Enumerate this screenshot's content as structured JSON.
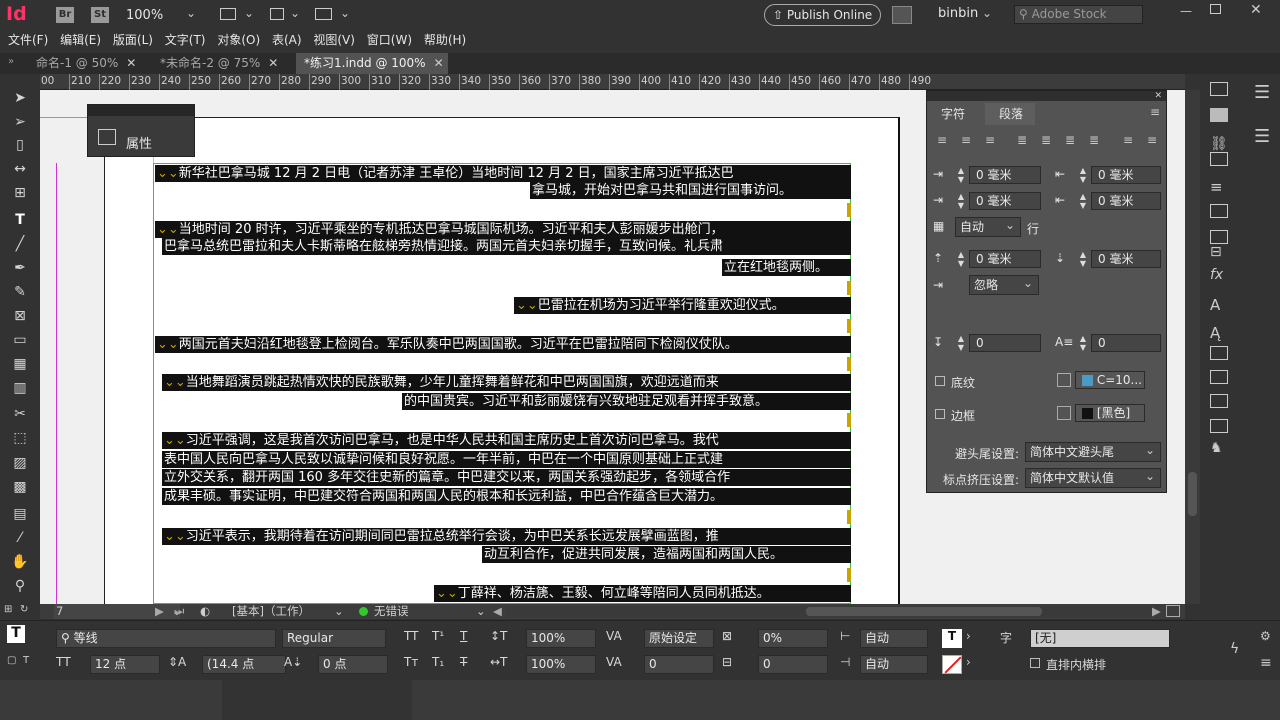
{
  "app": {
    "logo": "Id",
    "br": "Br",
    "st": "St",
    "zoom": "100%",
    "publish_label": "Publish Online",
    "user": "binbin",
    "search_placeholder": "Adobe Stock"
  },
  "menu": [
    "文件(F)",
    "编辑(E)",
    "版面(L)",
    "文字(T)",
    "对象(O)",
    "表(A)",
    "视图(V)",
    "窗口(W)",
    "帮助(H)"
  ],
  "tabs": [
    {
      "label": "命名-1 @ 50%"
    },
    {
      "label": "*未命名-2 @ 75%"
    },
    {
      "label": "*练习1.indd @ 100%"
    }
  ],
  "ruler_ticks": [
    "00",
    "210",
    "220",
    "230",
    "240",
    "250",
    "260",
    "270",
    "280",
    "290",
    "300",
    "310",
    "320",
    "330",
    "340",
    "350",
    "360",
    "370",
    "380",
    "390",
    "400",
    "410",
    "420",
    "430",
    "440",
    "450",
    "460",
    "470",
    "480",
    "490"
  ],
  "properties_panel": {
    "title": "属性"
  },
  "document_text": [
    "新华社巴拿马城 12 月 2 日电（记者苏津 王卓伦）当地时间 12 月 2 日，国家主席习近平抵达巴",
    "拿马城，开始对巴拿马共和国进行国事访问。",
    "当地时间 20 时许，习近平乘坐的专机抵达巴拿马城国际机场。习近平和夫人彭丽媛步出舱门，",
    "巴拿马总统巴雷拉和夫人卡斯蒂略在舷梯旁热情迎接。两国元首夫妇亲切握手，互致问候。礼兵肃",
    "立在红地毯两侧。",
    "巴雷拉在机场为习近平举行隆重欢迎仪式。",
    "两国元首夫妇沿红地毯登上检阅台。军乐队奏中巴两国国歌。习近平在巴雷拉陪同下检阅仪仗队。",
    "当地舞蹈演员跳起热情欢快的民族歌舞，少年儿童挥舞着鲜花和中巴两国国旗，欢迎远道而来",
    "的中国贵宾。习近平和彭丽媛饶有兴致地驻足观看并挥手致意。",
    "习近平强调，这是我首次访问巴拿马，也是中华人民共和国主席历史上首次访问巴拿马。我代",
    "表中国人民向巴拿马人民致以诚挚问候和良好祝愿。一年半前，中巴在一个中国原则基础上正式建",
    "立外交关系，翻开两国 160 多年交往史新的篇章。中巴建交以来，两国关系强劲起步，各领域合作",
    "成果丰硕。事实证明，中巴建交符合两国和两国人民的根本和长远利益，中巴合作蕴含巨大潜力。",
    "习近平表示，我期待着在访问期间同巴雷拉总统举行会谈，为中巴关系长远发展擘画蓝图，推",
    "动互利合作，促进共同发展，造福两国和两国人民。",
    "丁薛祥、杨洁篪、王毅、何立峰等陪同人员同机抵达。"
  ],
  "paragraph_panel": {
    "tab_char": "字符",
    "tab_para": "段落",
    "left_indent": "0 毫米",
    "right_indent": "0 毫米",
    "first_line_indent": "0 毫米",
    "last_line_indent": "0 毫米",
    "align_grid": "自动",
    "align_grid_unit": "行",
    "space_before": "0 毫米",
    "space_after": "0 毫米",
    "grid_align": "忽略",
    "drop_cap_lines": "0",
    "drop_cap_chars": "0",
    "shading_label": "底纹",
    "shading_color": "C=10...",
    "border_label": "边框",
    "border_color": "[黑色]",
    "kinsoku_label": "避头尾设置:",
    "kinsoku_value": "简体中文避头尾",
    "mojikumi_label": "标点挤压设置:",
    "mojikumi_value": "简体中文默认值"
  },
  "status_bar": {
    "page": "7",
    "style": "[基本]（工作）",
    "errors": "无错误"
  },
  "control_panel": {
    "font": "等线",
    "style": "Regular",
    "size": "12 点",
    "leading": "(14.4 点",
    "vscale": "100%",
    "hscale": "100%",
    "kerning": "原始设定",
    "tracking": "0",
    "tsume": "0%",
    "baseline": "0 点",
    "shift": "0",
    "auto1": "自动",
    "auto2": "自动",
    "grid_label": "字",
    "grid_value": "[无]",
    "tatechuyoko": "直排内横排"
  }
}
